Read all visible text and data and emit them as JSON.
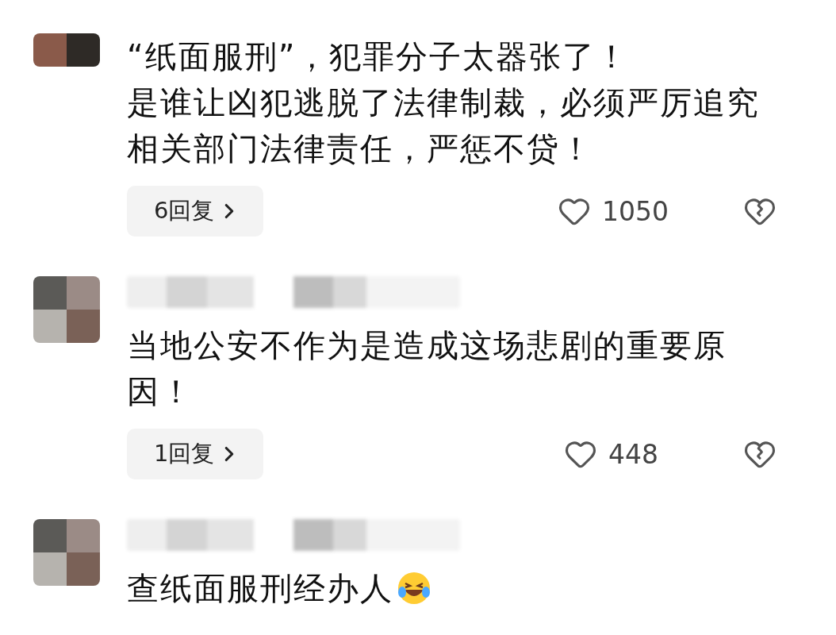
{
  "comments": [
    {
      "show_username": false,
      "text": [
        "“纸面服刑”，犯罪分子太器张了！",
        "是谁让凶犯逃脱了法律制裁，必须严厉追究相关部门法律责任，严惩不贷！"
      ],
      "replies": "6回复",
      "likes": "1050",
      "emoji": false
    },
    {
      "show_username": true,
      "text": [
        "当地公安不作为是造成这场悲剧的重要原因！"
      ],
      "replies": "1回复",
      "likes": "448",
      "emoji": false
    },
    {
      "show_username": true,
      "text": [
        "查纸面服刑经办人"
      ],
      "emoji": true
    }
  ]
}
